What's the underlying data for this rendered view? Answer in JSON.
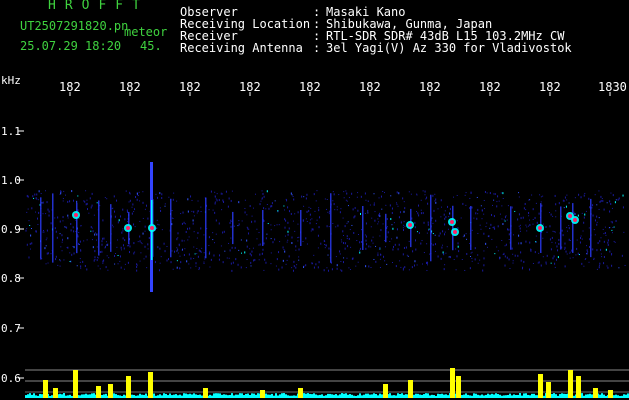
{
  "header": {
    "brand": "HROFFT",
    "filename": "UT2507291820.pn",
    "tag": "meteor",
    "datetime": "25.07.29 18:20",
    "number": "45."
  },
  "info": [
    {
      "label": "Observer",
      "sep": ":",
      "value": "Masaki Kano"
    },
    {
      "label": "Receiving Location",
      "sep": ":",
      "value": "Shibukawa, Gunma, Japan"
    },
    {
      "label": "Receiver",
      "sep": ":",
      "value": "RTL-SDR SDR# 43dB L15 103.2MHz CW"
    },
    {
      "label": "Receiving Antenna",
      "sep": ":",
      "value": "3el Yagi(V) Az 330 for Vladivostok"
    }
  ],
  "axis": {
    "y_unit": "kHz",
    "x_ticks": [
      "182",
      "182",
      "182",
      "182",
      "182",
      "182",
      "182",
      "182",
      "182",
      "1830"
    ],
    "y_ticks": [
      "1.1",
      "1.0",
      "0.9",
      "0.8",
      "0.7",
      "0.6"
    ]
  },
  "colors": {
    "background": "#000000",
    "header_text": "#3fd23f",
    "info_text": "#ffffff",
    "axis_text": "#ffffff",
    "signal_low": "#2222ff",
    "signal_mid": "#00ffff",
    "signal_high": "#ff2266",
    "histogram": "#ffff00",
    "histogram_base": "#00ffff"
  }
}
